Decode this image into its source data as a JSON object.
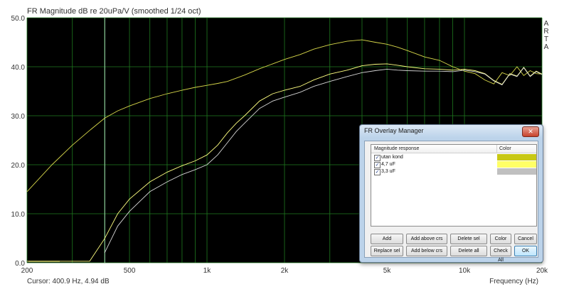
{
  "chart_data": {
    "type": "line",
    "title": "FR Magnitude dB re 20uPa/V (smoothed 1/24 oct)",
    "xlabel": "Frequency (Hz)",
    "ylabel": "",
    "x_scale": "log",
    "xlim": [
      200,
      20000
    ],
    "ylim": [
      0,
      50
    ],
    "grid": true,
    "y_ticks": [
      "0.0",
      "10.0",
      "20.0",
      "30.0",
      "40.0",
      "50.0"
    ],
    "x_tick_values": [
      200,
      500,
      1000,
      2000,
      5000,
      10000,
      20000
    ],
    "x_tick_labels": [
      "200",
      "500",
      "1k",
      "2k",
      "5k",
      "10k",
      "20k"
    ],
    "side_label": "A R T A",
    "cursor_line_x": 400.9,
    "cursor_readout": "Cursor: 400.9 Hz, 4.94 dB",
    "series": [
      {
        "name": "utan kond",
        "color": "#d8d84a",
        "x": [
          200,
          250,
          300,
          350,
          400,
          450,
          500,
          600,
          700,
          800,
          900,
          1000,
          1100,
          1200,
          1400,
          1600,
          1800,
          2000,
          2300,
          2600,
          3000,
          3500,
          4000,
          4500,
          5000,
          5500,
          6000,
          7000,
          8000,
          9000,
          10000,
          11000,
          12000,
          13000,
          14000,
          15000,
          16000,
          17000,
          18000,
          19000,
          20000
        ],
        "y": [
          14.5,
          20,
          24,
          27,
          29.5,
          31,
          32,
          33.5,
          34.5,
          35.2,
          35.8,
          36.2,
          36.6,
          37,
          38.3,
          39.6,
          40.6,
          41.5,
          42.5,
          43.6,
          44.5,
          45.2,
          45.5,
          45,
          44.6,
          44,
          43.3,
          42,
          41.3,
          40,
          39.1,
          38.6,
          37.3,
          36.5,
          38.8,
          38.2,
          40,
          38.2,
          39.2,
          38.6,
          38.5
        ]
      },
      {
        "name": "4,7 uF",
        "color": "#ffff80",
        "x": [
          200,
          350,
          400,
          450,
          500,
          600,
          700,
          800,
          900,
          1000,
          1100,
          1200,
          1300,
          1400,
          1600,
          1800,
          2000,
          2300,
          2600,
          3000,
          3500,
          4000,
          4500,
          5000,
          5500,
          6000,
          7000,
          8000,
          9000,
          10000,
          11000,
          12000,
          13000,
          14000,
          15000,
          16000,
          17000,
          18000,
          19000,
          20000
        ],
        "y": [
          0.3,
          0.3,
          4.9,
          10,
          13,
          16.5,
          18.5,
          19.8,
          20.8,
          22,
          24,
          26.5,
          28.5,
          30,
          33,
          34.5,
          35.2,
          36,
          37.3,
          38.5,
          39.3,
          40.2,
          40.5,
          40.6,
          40.3,
          40,
          39.6,
          39.5,
          39.3,
          39.5,
          39.2,
          38.6,
          37.2,
          36.4,
          38.6,
          38.1,
          39.9,
          38.1,
          39.1,
          38.5
        ]
      },
      {
        "name": "3,3 uF",
        "color": "#d4d4d4",
        "x": [
          400,
          450,
          500,
          600,
          700,
          800,
          900,
          1000,
          1100,
          1200,
          1300,
          1400,
          1600,
          1800,
          2000,
          2300,
          2600,
          3000,
          3500,
          4000,
          4500,
          5000,
          5500,
          6000,
          7000,
          8000,
          9000,
          10000,
          11000,
          12000,
          13000,
          14000,
          15000,
          16000,
          17000,
          18000,
          19000,
          20000
        ],
        "y": [
          2,
          7.5,
          10.5,
          14.5,
          16.5,
          18,
          19,
          20,
          22,
          24.5,
          26.8,
          28.5,
          31.5,
          33,
          33.8,
          34.8,
          36,
          37,
          38,
          38.8,
          39.2,
          39.5,
          39.3,
          39.2,
          39.1,
          39.1,
          39,
          39.3,
          39,
          38.5,
          37.1,
          36.3,
          38.5,
          38,
          39.8,
          38,
          39,
          38.4
        ]
      }
    ]
  },
  "dialog": {
    "title": "FR Overlay Manager",
    "close_label": "✕",
    "column_headers": {
      "name": "Magnitude response",
      "color": "Color"
    },
    "rows": [
      {
        "label": "utan kond",
        "checked": "✓",
        "color": "#c8c814"
      },
      {
        "label": "4,7 uF",
        "checked": "✓",
        "color": "#ffff66"
      },
      {
        "label": "3,3 uF",
        "checked": "✓",
        "color": "#c0c0c0"
      }
    ],
    "buttons": {
      "add": "Add",
      "add_above": "Add above crs",
      "delete_sel": "Delete sel",
      "color": "Color",
      "cancel": "Cancel",
      "replace_sel": "Replace sel",
      "add_below": "Add below crs",
      "delete_all": "Delete all",
      "check_all": "Check All",
      "ok": "OK"
    }
  }
}
